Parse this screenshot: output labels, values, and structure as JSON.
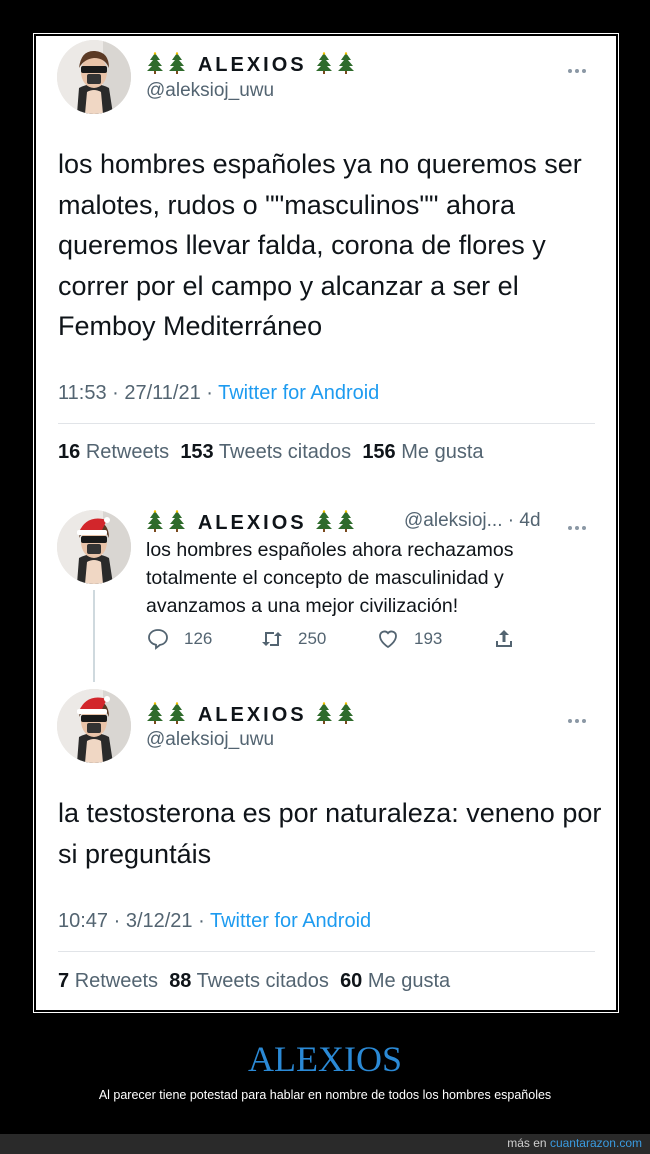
{
  "tweet1": {
    "display_name": "ALEXIOS",
    "handle": "@aleksioj_uwu",
    "text": "los hombres españoles ya no queremos ser malotes, rudos o \"\"masculinos\"\" ahora queremos llevar falda, corona de flores y correr por el campo y alcanzar a ser el Femboy Mediterráneo",
    "time": "11:53 · 27/11/21 · ",
    "source": "Twitter for Android",
    "stats": {
      "retweets": "16",
      "retweets_label": "Retweets",
      "quotes": "153",
      "quotes_label": "Tweets citados",
      "likes": "156",
      "likes_label": "Me gusta"
    }
  },
  "reply": {
    "display_name": "ALEXIOS",
    "handle_time": "@aleksioj... · 4d",
    "text": "los hombres españoles ahora rechazamos totalmente el concepto de masculinidad y avanzamos a una mejor civilización!",
    "replies": "126",
    "retweets": "250",
    "likes": "193"
  },
  "tweet2": {
    "display_name": "ALEXIOS",
    "handle": "@aleksioj_uwu",
    "text": "la testosterona es por naturaleza: veneno por si preguntáis",
    "time": "10:47 · 3/12/21 · ",
    "source": "Twitter for Android",
    "stats": {
      "retweets": "7",
      "retweets_label": "Retweets",
      "quotes": "88",
      "quotes_label": "Tweets citados",
      "likes": "60",
      "likes_label": "Me gusta"
    }
  },
  "caption": {
    "title": "ALEXIOS",
    "subtitle": "Al parecer tiene potestad para hablar en nombre de todos los hombres españoles"
  },
  "footer": {
    "prefix": "más en ",
    "site": "cuantarazon.com"
  },
  "colors": {
    "link": "#1d9bf0",
    "caption_title": "#2b8ad6",
    "muted": "#536471",
    "text": "#0f1419"
  },
  "icons": [
    "christmas-tree-icon",
    "more-icon",
    "reply-icon",
    "retweet-icon",
    "like-icon",
    "share-icon"
  ]
}
